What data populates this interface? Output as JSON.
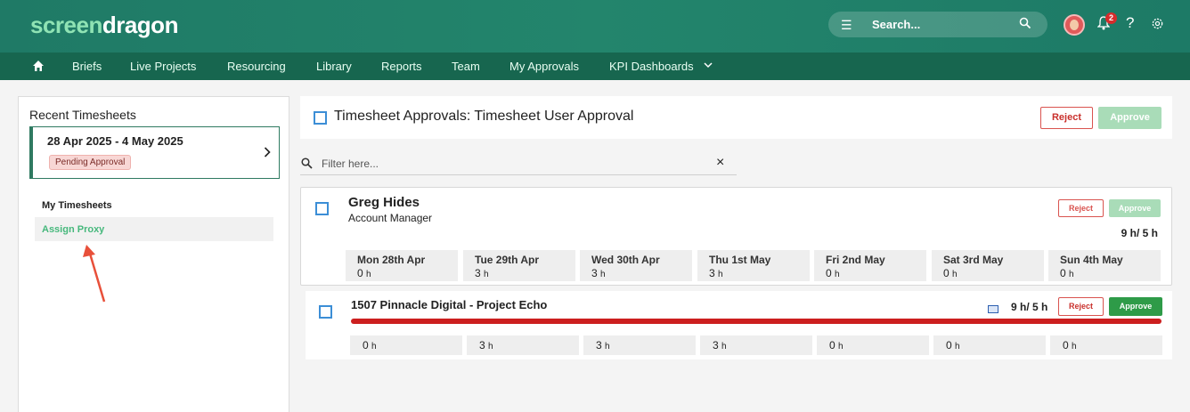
{
  "header": {
    "logo_part1": "screen",
    "logo_part2": "dragon",
    "search_placeholder": "Search...",
    "notification_count": "2",
    "help_label": "?"
  },
  "nav": {
    "items": [
      "Briefs",
      "Live Projects",
      "Resourcing",
      "Library",
      "Reports",
      "Team",
      "My Approvals",
      "KPI Dashboards"
    ]
  },
  "sidebar": {
    "title": "Recent Timesheets",
    "timesheet": {
      "date_range": "28 Apr 2025 - 4 May 2025",
      "status": "Pending Approval"
    },
    "links": [
      "My Timesheets",
      "Assign Proxy"
    ]
  },
  "main": {
    "title": "Timesheet Approvals: Timesheet User Approval",
    "reject_label": "Reject",
    "approve_label": "Approve",
    "filter_placeholder": "Filter here...",
    "clear_icon": "×"
  },
  "user": {
    "name": "Greg Hides",
    "role": "Account Manager",
    "total": "9 h/ 5 h",
    "days": [
      {
        "name": "Mon 28th Apr",
        "value": "0",
        "unit": "h"
      },
      {
        "name": "Tue 29th Apr",
        "value": "3",
        "unit": "h"
      },
      {
        "name": "Wed 30th Apr",
        "value": "3",
        "unit": "h"
      },
      {
        "name": "Thu 1st May",
        "value": "3",
        "unit": "h"
      },
      {
        "name": "Fri 2nd May",
        "value": "0",
        "unit": "h"
      },
      {
        "name": "Sat 3rd May",
        "value": "0",
        "unit": "h"
      },
      {
        "name": "Sun 4th May",
        "value": "0",
        "unit": "h"
      }
    ]
  },
  "project": {
    "title": "1507 Pinnacle Digital - Project Echo",
    "total": "9 h/ 5 h",
    "cells": [
      {
        "value": "0",
        "unit": "h"
      },
      {
        "value": "3",
        "unit": "h"
      },
      {
        "value": "3",
        "unit": "h"
      },
      {
        "value": "3",
        "unit": "h"
      },
      {
        "value": "0",
        "unit": "h"
      },
      {
        "value": "0",
        "unit": "h"
      },
      {
        "value": "0",
        "unit": "h"
      }
    ]
  },
  "colors": {
    "brand": "#1f7a66",
    "nav": "#17664f",
    "approve": "#2e9b48",
    "reject": "#c9302c",
    "progress": "#cc1f1f"
  }
}
